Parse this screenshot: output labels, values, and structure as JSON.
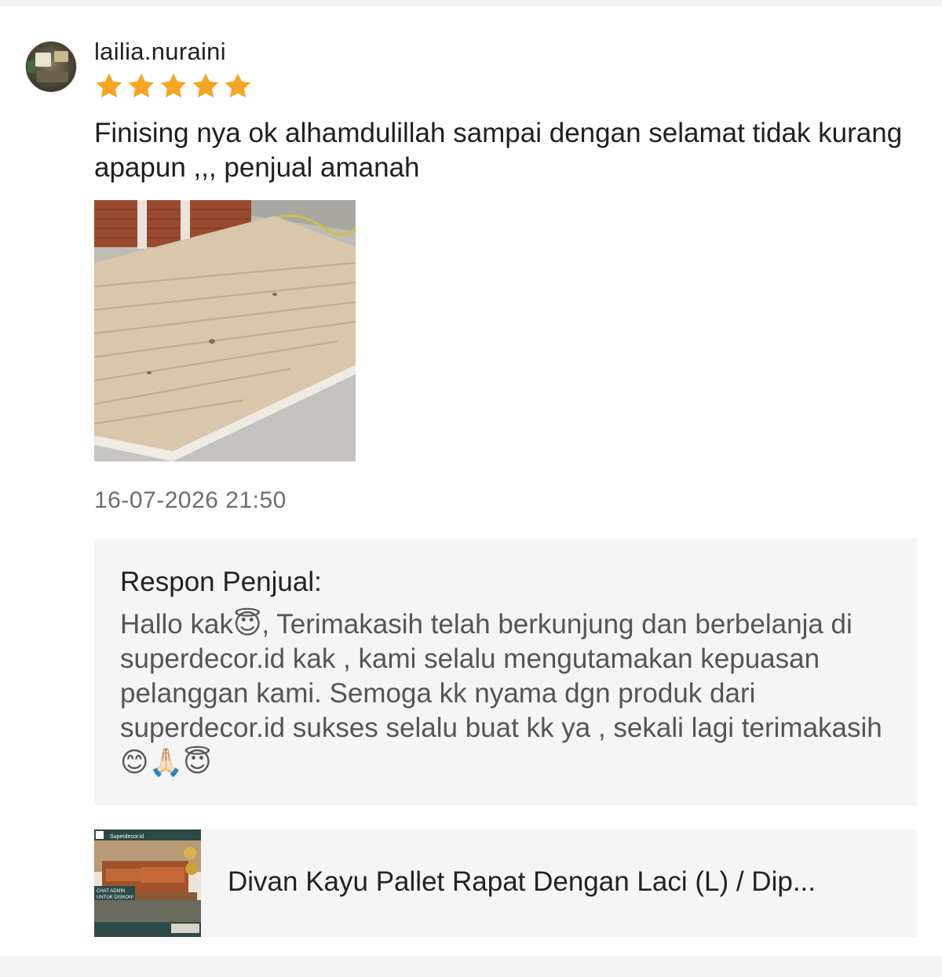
{
  "reviewer": {
    "username": "lailia.nuraini",
    "rating": 5,
    "rating_max": 5
  },
  "review": {
    "text": "Finising nya ok alhamdulillah sampai dengan selamat tidak kurang apapun ,,, penjual amanah",
    "timestamp": "16-07-2026 21:50"
  },
  "seller_reply": {
    "title": "Respon Penjual:",
    "text": "Hallo kak😇, Terimakasih telah berkunjung dan berbelanja di superdecor.id kak , kami selalu mengutamakan kepuasan pelanggan kami. Semoga kk nyama dgn produk dari superdecor.id sukses selalu buat kk ya , sekali lagi terimakasih😊🙏🏻😇"
  },
  "product": {
    "name": "Divan Kayu Pallet Rapat Dengan Laci (L) / Dip...",
    "thumbnail_texts": [
      "Superdecor.id",
      "CHAT ADMIN",
      "UNTUK DISKON!"
    ]
  },
  "colors": {
    "star": "#f6a623",
    "reply_bg": "#f5f5f5",
    "timestamp": "#6e6e6e"
  }
}
